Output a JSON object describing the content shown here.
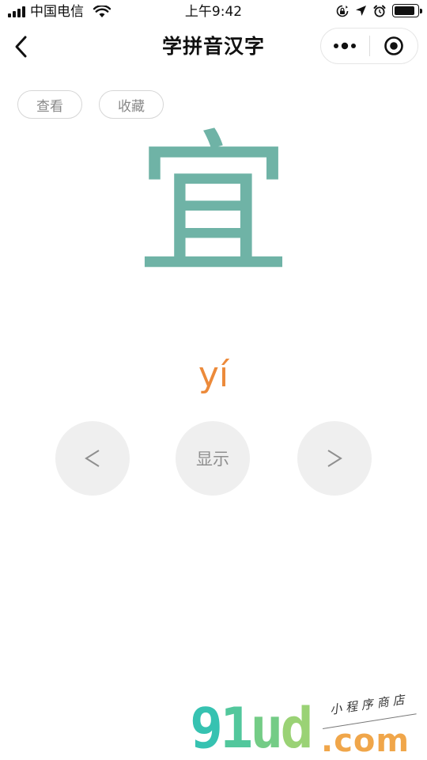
{
  "status_bar": {
    "carrier": "中国电信",
    "time": "上午9:42",
    "battery_level": 0.9,
    "icons": [
      "signal-icon",
      "wifi-icon",
      "orientation-lock-icon",
      "location-icon",
      "alarm-icon",
      "battery-icon"
    ]
  },
  "navbar": {
    "title": "学拼音汉字",
    "icons": [
      "back-chevron-icon",
      "more-dots-icon",
      "target-circle-icon"
    ]
  },
  "actions": {
    "view_label": "查看",
    "favorite_label": "收藏"
  },
  "card": {
    "character": "宜",
    "pinyin": "yí"
  },
  "controls": {
    "prev_label": "<",
    "show_label": "显示",
    "next_label": ">"
  },
  "watermark": {
    "brand": "91ud",
    "domain": ".com",
    "subtitle": "小程序商店"
  },
  "colors": {
    "character": "#6fb3a6",
    "pinyin": "#ec8a3a",
    "control_bg": "#efefef",
    "control_text": "#8f8f8f",
    "button_border": "#d6d6d6"
  }
}
